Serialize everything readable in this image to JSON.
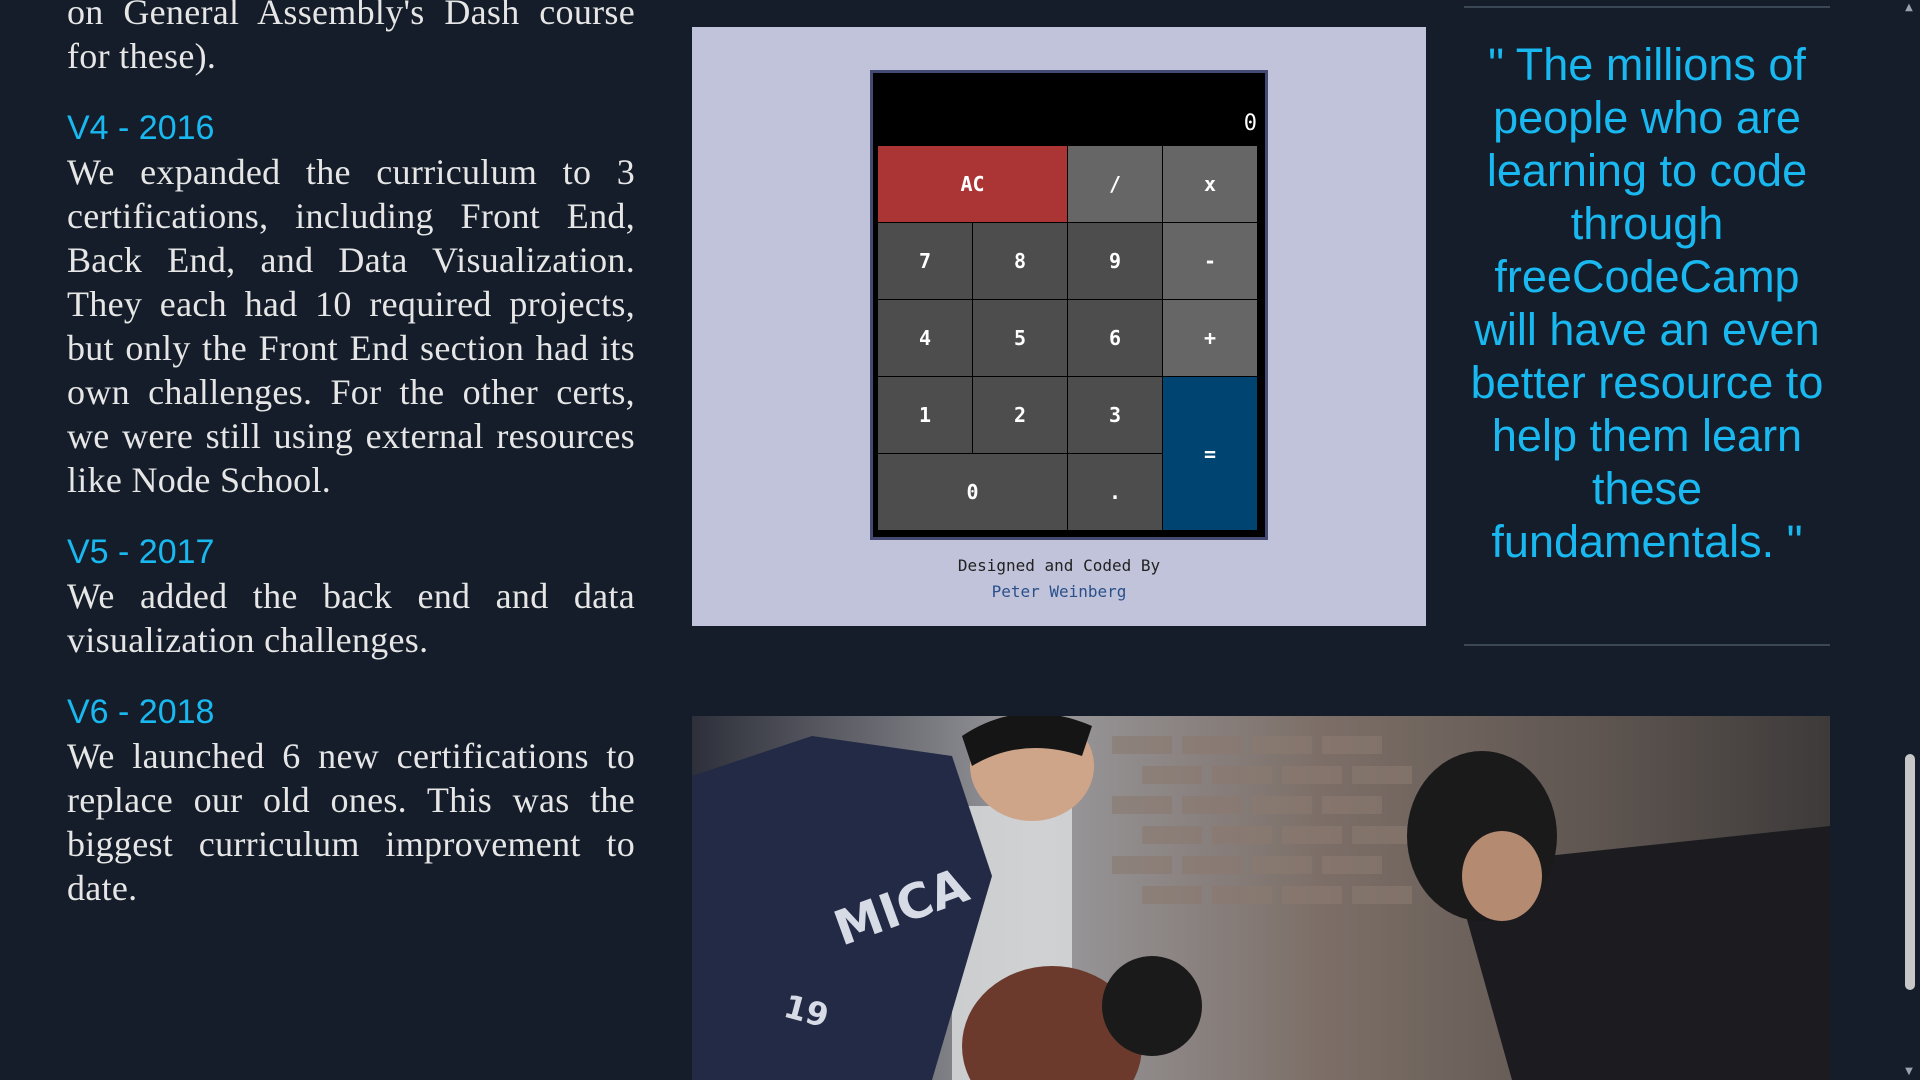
{
  "left": {
    "intro_tail": "on General Assembly's Dash course for these).",
    "sections": [
      {
        "title": "V4 - 2016",
        "text": "We expanded the curriculum to 3 certifications, including Front End, Back End, and Data Visualization. They each had 10 required projects, but only the Front End section had its own challenges. For the other certs, we were still using external resources like Node School."
      },
      {
        "title": "V5 - 2017",
        "text": "We added the back end and data visualization challenges."
      },
      {
        "title": "V6 - 2018",
        "text": "We launched 6 new certifications to replace our old ones. This was the biggest curriculum improvement to date."
      }
    ]
  },
  "calculator": {
    "display": "0",
    "keys": {
      "ac": "AC",
      "divide": "/",
      "multiply": "x",
      "seven": "7",
      "eight": "8",
      "nine": "9",
      "minus": "-",
      "four": "4",
      "five": "5",
      "six": "6",
      "plus": "+",
      "one": "1",
      "two": "2",
      "three": "3",
      "equals": "=",
      "zero": "0",
      "decimal": "."
    },
    "credit_line": "Designed and Coded By",
    "credit_author": "Peter Weinberg"
  },
  "quote": {
    "text": "\" The millions of people who are learning to code through freeCodeCamp will have an even better resource to help them learn these fundamentals. \""
  },
  "photo": {
    "shirt_text": "MICA",
    "shirt_number": "19"
  },
  "colors": {
    "background": "#141d29",
    "accent": "#19b8f0",
    "ac_key": "#ab3434",
    "equals_key": "#004471",
    "calc_panel": "#c1c3da"
  }
}
